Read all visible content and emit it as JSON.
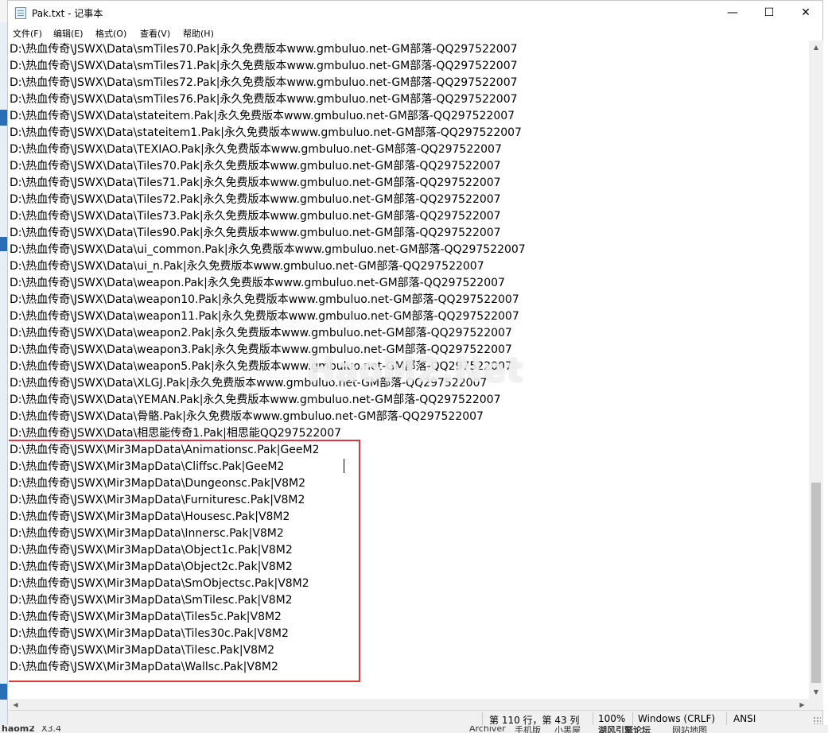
{
  "window": {
    "title": "Pak.txt - 记事本",
    "buttons": {
      "minimize": "—",
      "maximize": "☐",
      "close": "✕"
    }
  },
  "menu": [
    {
      "label": "文件(F)"
    },
    {
      "label": "编辑(E)"
    },
    {
      "label": "格式(O)"
    },
    {
      "label": "查看(V)"
    },
    {
      "label": "帮助(H)"
    }
  ],
  "editor": {
    "lines": [
      "D:\\热血传奇\\JSWX\\Data\\smTiles70.Pak|永久免费版本www.gmbuluo.net-GM部落-QQ297522007",
      "D:\\热血传奇\\JSWX\\Data\\smTiles71.Pak|永久免费版本www.gmbuluo.net-GM部落-QQ297522007",
      "D:\\热血传奇\\JSWX\\Data\\smTiles72.Pak|永久免费版本www.gmbuluo.net-GM部落-QQ297522007",
      "D:\\热血传奇\\JSWX\\Data\\smTiles76.Pak|永久免费版本www.gmbuluo.net-GM部落-QQ297522007",
      "D:\\热血传奇\\JSWX\\Data\\stateitem.Pak|永久免费版本www.gmbuluo.net-GM部落-QQ297522007",
      "D:\\热血传奇\\JSWX\\Data\\stateitem1.Pak|永久免费版本www.gmbuluo.net-GM部落-QQ297522007",
      "D:\\热血传奇\\JSWX\\Data\\TEXIAO.Pak|永久免费版本www.gmbuluo.net-GM部落-QQ297522007",
      "D:\\热血传奇\\JSWX\\Data\\Tiles70.Pak|永久免费版本www.gmbuluo.net-GM部落-QQ297522007",
      "D:\\热血传奇\\JSWX\\Data\\Tiles71.Pak|永久免费版本www.gmbuluo.net-GM部落-QQ297522007",
      "D:\\热血传奇\\JSWX\\Data\\Tiles72.Pak|永久免费版本www.gmbuluo.net-GM部落-QQ297522007",
      "D:\\热血传奇\\JSWX\\Data\\Tiles73.Pak|永久免费版本www.gmbuluo.net-GM部落-QQ297522007",
      "D:\\热血传奇\\JSWX\\Data\\Tiles90.Pak|永久免费版本www.gmbuluo.net-GM部落-QQ297522007",
      "D:\\热血传奇\\JSWX\\Data\\ui_common.Pak|永久免费版本www.gmbuluo.net-GM部落-QQ297522007",
      "D:\\热血传奇\\JSWX\\Data\\ui_n.Pak|永久免费版本www.gmbuluo.net-GM部落-QQ297522007",
      "D:\\热血传奇\\JSWX\\Data\\weapon.Pak|永久免费版本www.gmbuluo.net-GM部落-QQ297522007",
      "D:\\热血传奇\\JSWX\\Data\\weapon10.Pak|永久免费版本www.gmbuluo.net-GM部落-QQ297522007",
      "D:\\热血传奇\\JSWX\\Data\\weapon11.Pak|永久免费版本www.gmbuluo.net-GM部落-QQ297522007",
      "D:\\热血传奇\\JSWX\\Data\\weapon2.Pak|永久免费版本www.gmbuluo.net-GM部落-QQ297522007",
      "D:\\热血传奇\\JSWX\\Data\\weapon3.Pak|永久免费版本www.gmbuluo.net-GM部落-QQ297522007",
      "D:\\热血传奇\\JSWX\\Data\\weapon5.Pak|永久免费版本www.gmbuluo.net-GM部落-QQ297522007",
      "D:\\热血传奇\\JSWX\\Data\\XLGJ.Pak|永久免费版本www.gmbuluo.net-GM部落-QQ297522007",
      "D:\\热血传奇\\JSWX\\Data\\YEMAN.Pak|永久免费版本www.gmbuluo.net-GM部落-QQ297522007",
      "D:\\热血传奇\\JSWX\\Data\\骨骼.Pak|永久免费版本www.gmbuluo.net-GM部落-QQ297522007",
      "D:\\热血传奇\\JSWX\\Data\\相思能传奇1.Pak|相思能QQ297522007",
      "D:\\热血传奇\\JSWX\\Mir3MapData\\Animationsc.Pak|GeeM2",
      "D:\\热血传奇\\JSWX\\Mir3MapData\\Cliffsc.Pak|GeeM2",
      "D:\\热血传奇\\JSWX\\Mir3MapData\\Dungeonsc.Pak|V8M2",
      "D:\\热血传奇\\JSWX\\Mir3MapData\\Furnituresc.Pak|V8M2",
      "D:\\热血传奇\\JSWX\\Mir3MapData\\Housesc.Pak|V8M2",
      "D:\\热血传奇\\JSWX\\Mir3MapData\\Innersc.Pak|V8M2",
      "D:\\热血传奇\\JSWX\\Mir3MapData\\Object1c.Pak|V8M2",
      "D:\\热血传奇\\JSWX\\Mir3MapData\\Object2c.Pak|V8M2",
      "D:\\热血传奇\\JSWX\\Mir3MapData\\SmObjectsc.Pak|V8M2",
      "D:\\热血传奇\\JSWX\\Mir3MapData\\SmTilesc.Pak|V8M2",
      "D:\\热血传奇\\JSWX\\Mir3MapData\\Tiles5c.Pak|V8M2",
      "D:\\热血传奇\\JSWX\\Mir3MapData\\Tiles30c.Pak|V8M2",
      "D:\\热血传奇\\JSWX\\Mir3MapData\\Tilesc.Pak|V8M2",
      "D:\\热血传奇\\JSWX\\Mir3MapData\\Wallsc.Pak|V8M2"
    ]
  },
  "watermark": "HaoM2.Net",
  "statusbar": {
    "position": "第 110 行，第 43 列",
    "zoom": "100%",
    "line_ending": "Windows (CRLF)",
    "encoding": "ANSI"
  },
  "background_taskbar": [
    "haom2",
    "X3.4",
    "Archiver",
    "手机版",
    "小黑屋",
    "湖风引擎论坛",
    "网站地图"
  ],
  "colors": {
    "highlight_border": "#d9383c",
    "scroll_thumb": "#c2c2c2"
  }
}
